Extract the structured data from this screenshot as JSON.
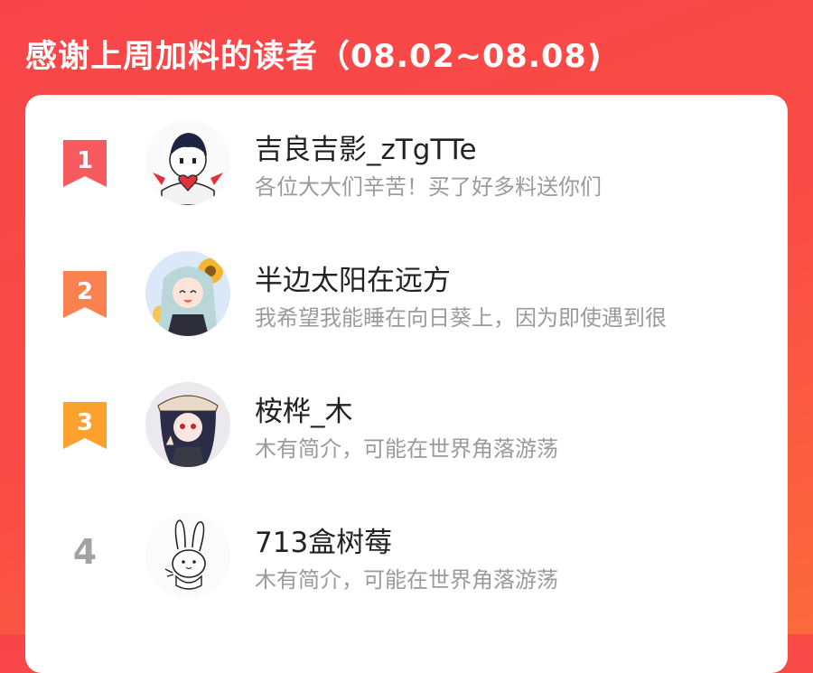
{
  "header": {
    "title": "感谢上周加料的读者（08.02~08.08)"
  },
  "colors": {
    "background": "#f8454a",
    "rank1": "#f75b5f",
    "rank2": "#fb8151",
    "rank3": "#fca12e",
    "rank_plain": "#a3a3a3"
  },
  "readers": [
    {
      "rank": "1",
      "name": "吉良吉影_zTgTTe",
      "desc": "各位大大们辛苦！买了好多料送你们",
      "avatar": "boy-holding-heart-avatar"
    },
    {
      "rank": "2",
      "name": "半边太阳在远方",
      "desc": "我希望我能睡在向日葵上，因为即使遇到很",
      "avatar": "anime-girl-sunflower-avatar"
    },
    {
      "rank": "3",
      "name": "桉桦_木",
      "desc": "木有简介，可能在世界角落游荡",
      "avatar": "anime-girl-hat-avatar"
    },
    {
      "rank": "4",
      "name": "713盒树莓",
      "desc": "木有简介，可能在世界角落游荡",
      "avatar": "bunny-doodle-avatar"
    }
  ]
}
